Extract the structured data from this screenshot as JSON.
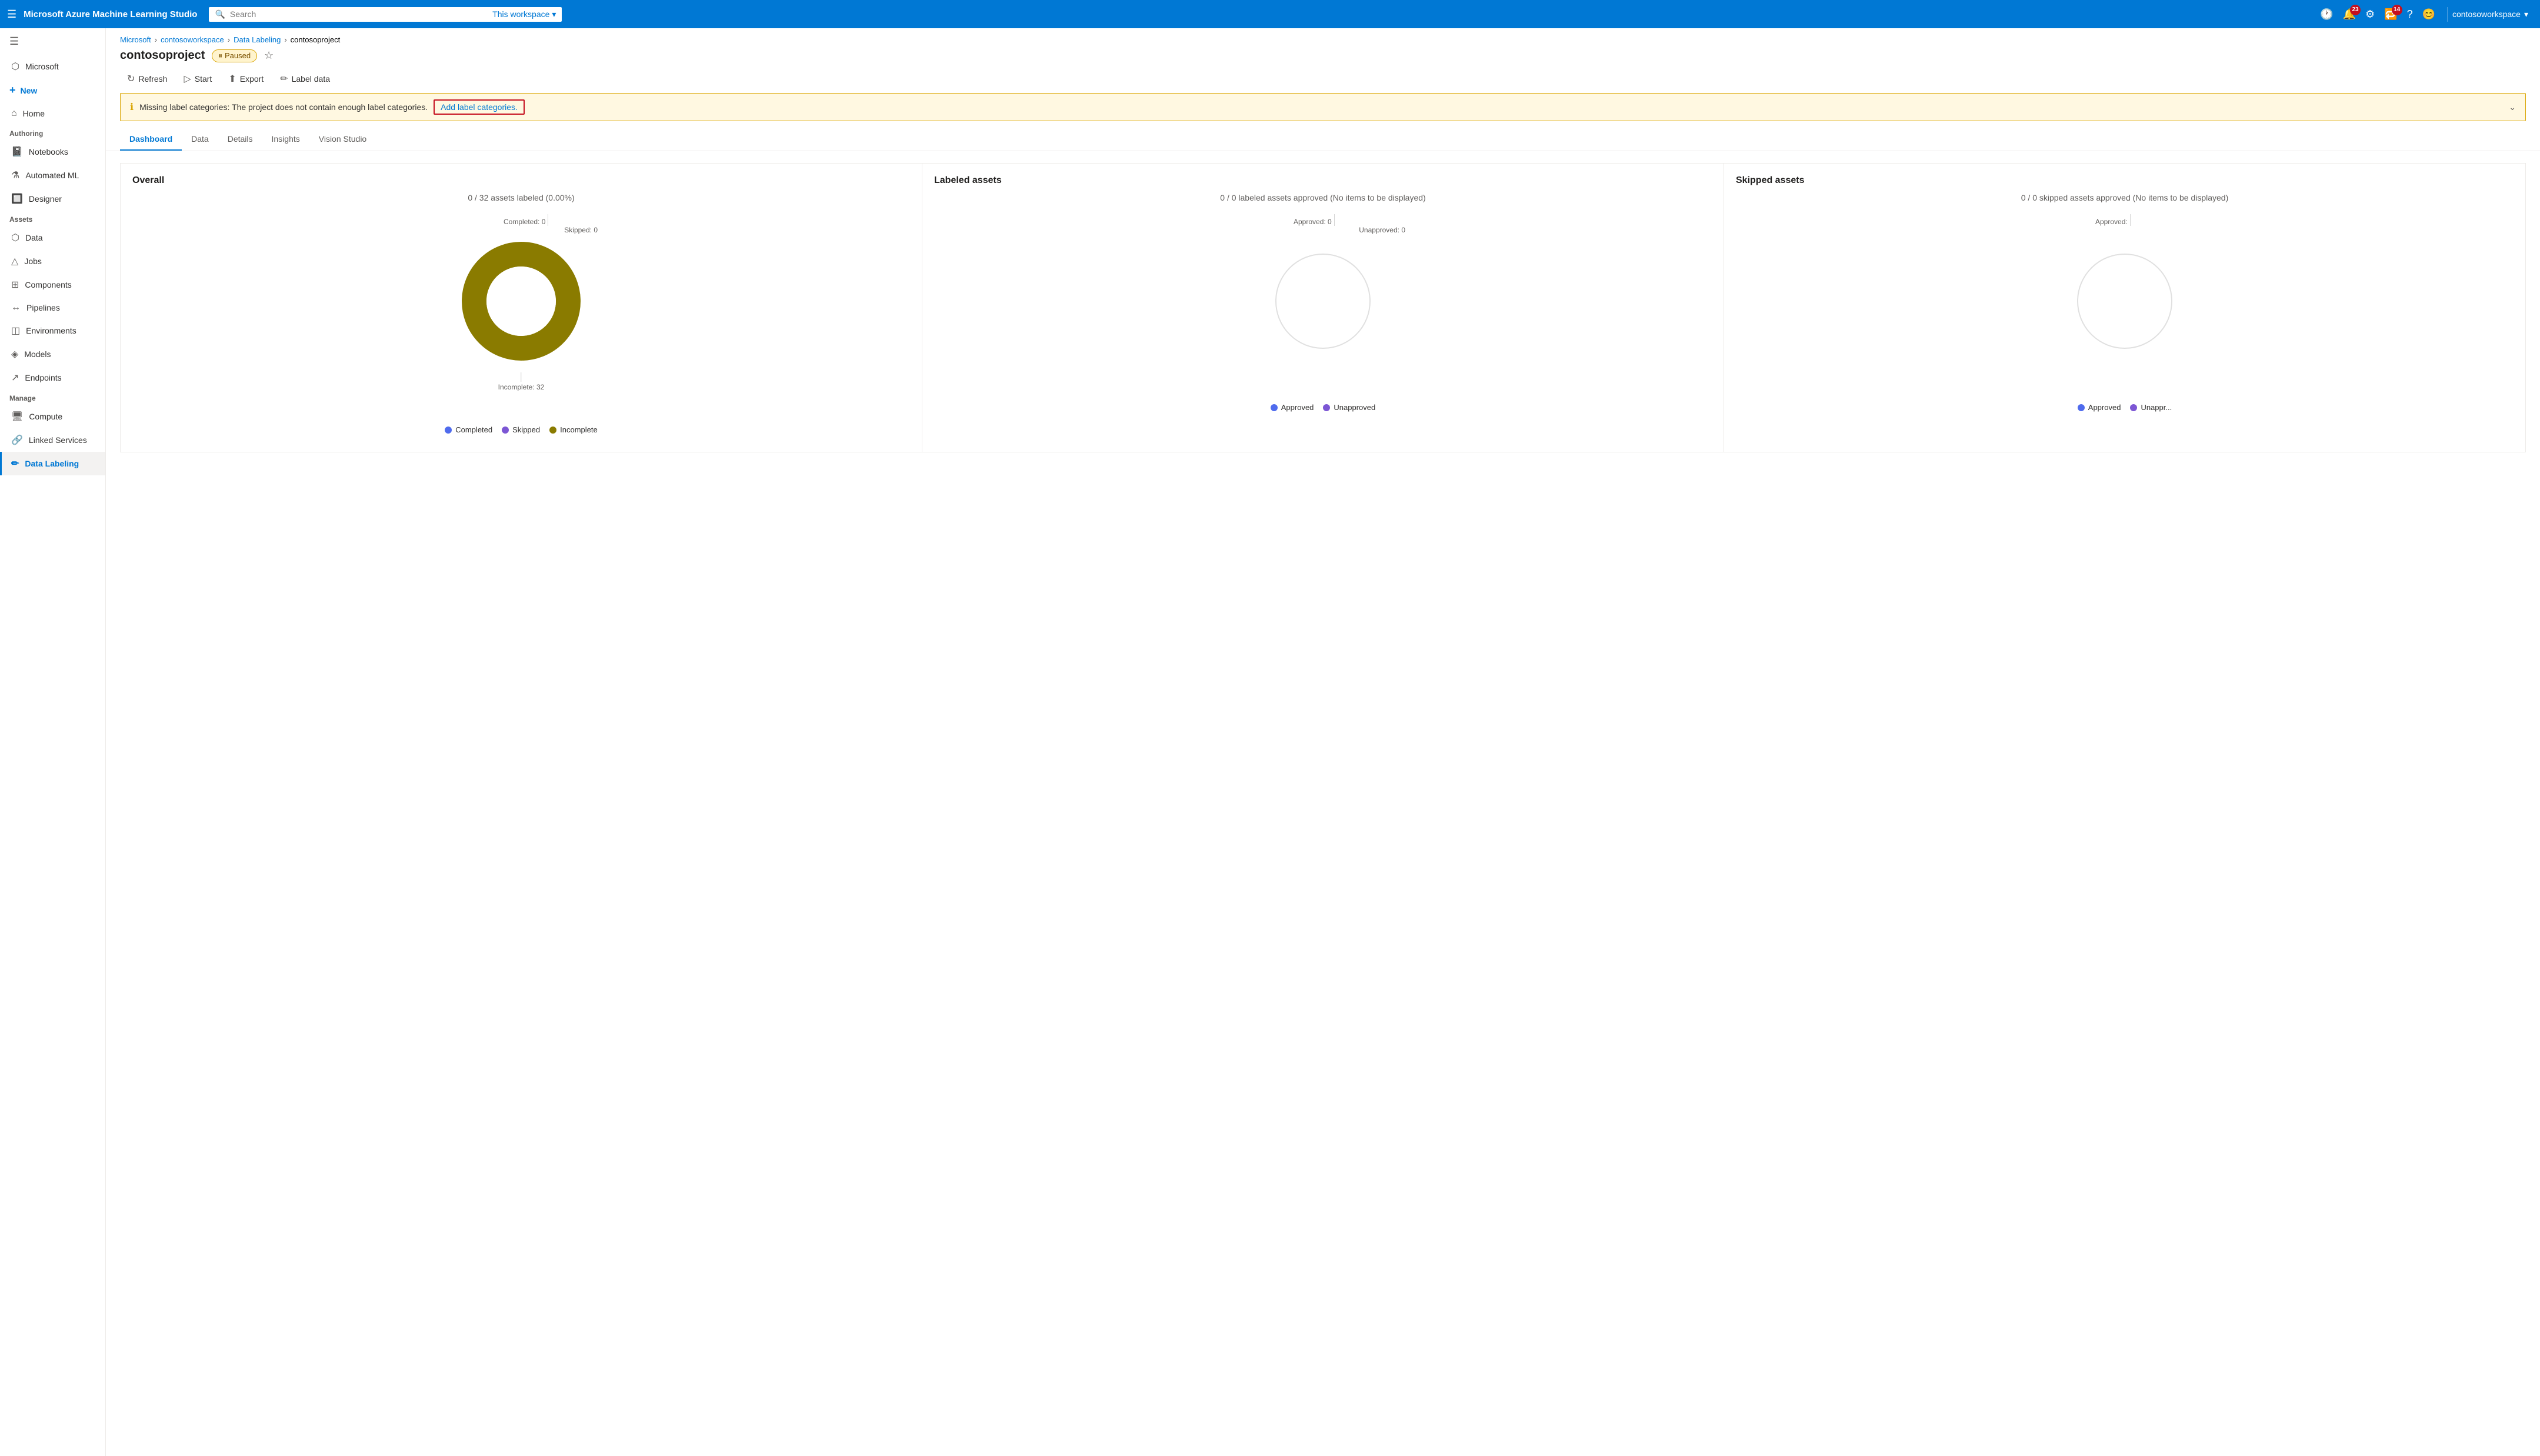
{
  "app": {
    "brand": "Microsoft Azure Machine Learning Studio"
  },
  "topnav": {
    "search_placeholder": "Search",
    "search_workspace": "This workspace",
    "notifications_count": "23",
    "updates_count": "14",
    "username": "contosoworkspace"
  },
  "sidebar": {
    "microsoft_label": "Microsoft",
    "new_label": "New",
    "home_label": "Home",
    "authoring_label": "Authoring",
    "notebooks_label": "Notebooks",
    "automated_ml_label": "Automated ML",
    "designer_label": "Designer",
    "assets_label": "Assets",
    "data_label": "Data",
    "jobs_label": "Jobs",
    "components_label": "Components",
    "pipelines_label": "Pipelines",
    "environments_label": "Environments",
    "models_label": "Models",
    "endpoints_label": "Endpoints",
    "manage_label": "Manage",
    "compute_label": "Compute",
    "linked_services_label": "Linked Services",
    "data_labeling_label": "Data Labeling"
  },
  "breadcrumb": {
    "microsoft": "Microsoft",
    "workspace": "contosoworkspace",
    "data_labeling": "Data Labeling",
    "project": "contosoproject"
  },
  "page": {
    "title": "contosoproject",
    "status": "Paused"
  },
  "toolbar": {
    "refresh": "Refresh",
    "start": "Start",
    "export": "Export",
    "label_data": "Label data"
  },
  "warning": {
    "message": "Missing label categories: The project does not contain enough label categories.",
    "action": "Add label categories."
  },
  "tabs": {
    "dashboard": "Dashboard",
    "data": "Data",
    "details": "Details",
    "insights": "Insights",
    "vision_studio": "Vision Studio"
  },
  "overall_card": {
    "title": "Overall",
    "subtitle": "0 / 32 assets labeled (0.00%)",
    "completed_label": "Completed: 0",
    "skipped_label": "Skipped: 0",
    "incomplete_label": "Incomplete: 32",
    "legend_completed": "Completed",
    "legend_skipped": "Skipped",
    "legend_incomplete": "Incomplete",
    "colors": {
      "completed": "#4f6bed",
      "skipped": "#7c56d4",
      "incomplete": "#8a7b00"
    },
    "donut_color": "#8a7b00"
  },
  "labeled_card": {
    "title": "Labeled assets",
    "subtitle": "0 / 0 labeled assets approved (No items to be displayed)",
    "approved_label": "Approved: 0",
    "unapproved_label": "Unapproved: 0",
    "legend_approved": "Approved",
    "legend_unapproved": "Unapproved",
    "colors": {
      "approved": "#4f6bed",
      "unapproved": "#7c56d4"
    }
  },
  "skipped_card": {
    "title": "Skipped assets",
    "subtitle": "0 / 0 skipped assets approved (No items to be displayed)",
    "approved_label": "Approved:",
    "legend_approved": "Approved",
    "legend_unapproved": "Unappr...",
    "colors": {
      "approved": "#4f6bed",
      "unapproved": "#7c56d4"
    }
  }
}
